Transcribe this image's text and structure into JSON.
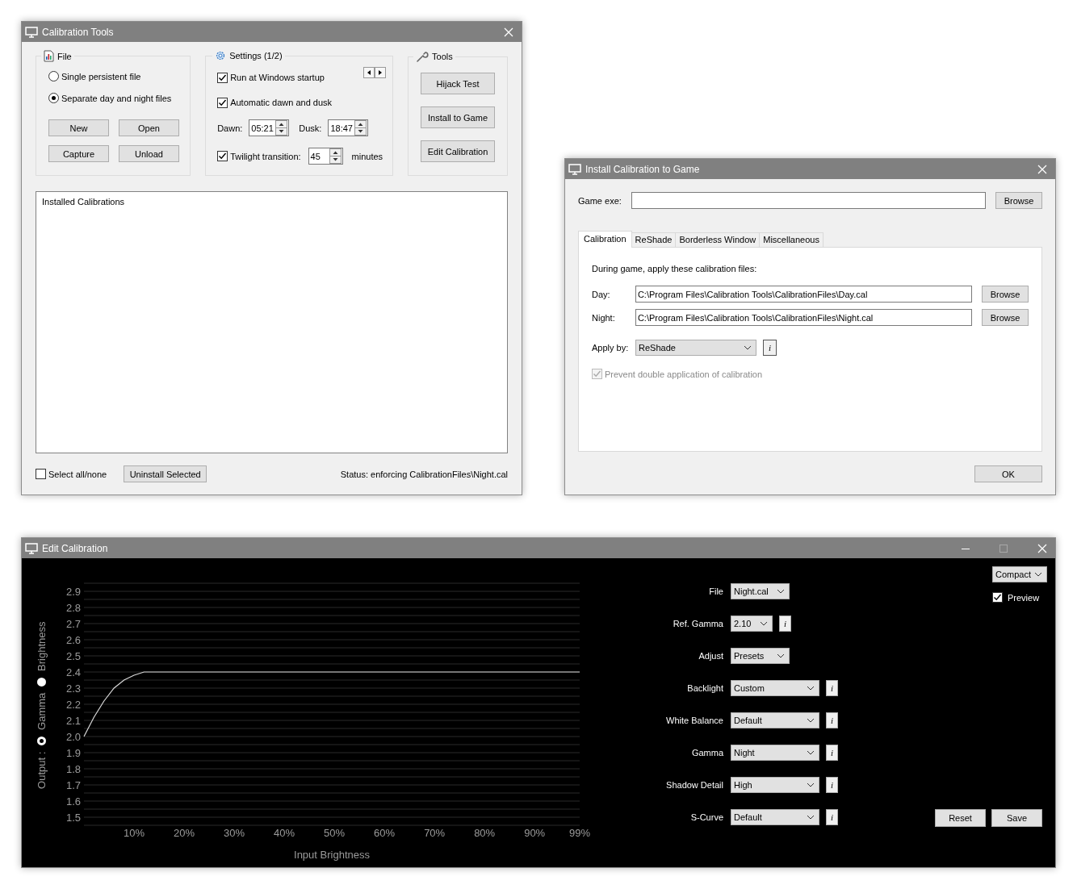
{
  "calibration_tools": {
    "title": "Calibration Tools",
    "file_group": {
      "title": "File",
      "options": [
        {
          "label": "Single persistent file",
          "selected": false
        },
        {
          "label": "Separate day and night files",
          "selected": true
        }
      ],
      "buttons": [
        "New",
        "Open",
        "Capture",
        "Unload"
      ]
    },
    "settings_group": {
      "title": "Settings (1/2)",
      "checkboxes": [
        {
          "label": "Run at Windows startup",
          "checked": true
        },
        {
          "label": "Automatic dawn and dusk",
          "checked": true
        }
      ],
      "dawn": {
        "label": "Dawn:",
        "value": "05:21"
      },
      "dusk": {
        "label": "Dusk:",
        "value": "18:47"
      },
      "twilight": {
        "label": "Twilight transition:",
        "checked": true,
        "value": "45",
        "unit": "minutes"
      }
    },
    "tools_group": {
      "title": "Tools",
      "buttons": [
        "Hijack Test",
        "Install to Game",
        "Edit Calibration"
      ]
    },
    "list": {
      "header": "Installed Calibrations"
    },
    "select_all": {
      "label": "Select all/none",
      "checked": false
    },
    "uninstall_button": "Uninstall Selected",
    "status": "Status: enforcing CalibrationFiles\\Night.cal"
  },
  "install_window": {
    "title": "Install Calibration to Game",
    "game_exe": {
      "label": "Game exe:",
      "button": "Browse"
    },
    "tabs": [
      {
        "label": "Calibration",
        "selected": true
      },
      {
        "label": "ReShade",
        "selected": false
      },
      {
        "label": "Borderless Window",
        "selected": false
      },
      {
        "label": "Miscellaneous",
        "selected": false
      }
    ],
    "intro": "During game, apply these calibration files:",
    "files": [
      {
        "label": "Day:",
        "value": "C:\\Program Files\\Calibration Tools\\CalibrationFiles\\Day.cal",
        "button": "Browse"
      },
      {
        "label": "Night:",
        "value": "C:\\Program Files\\Calibration Tools\\CalibrationFiles\\Night.cal",
        "button": "Browse"
      }
    ],
    "apply_by": {
      "label": "Apply by:",
      "value": "ReShade",
      "info": "i"
    },
    "prevent": {
      "label": "Prevent double application of calibration",
      "checked": true,
      "disabled": true
    },
    "ok_button": "OK"
  },
  "edit_window": {
    "title": "Edit Calibration",
    "output_label": "Output :",
    "axis_options": [
      {
        "label": "Gamma",
        "selected": true
      },
      {
        "label": "Brightness",
        "selected": false
      }
    ],
    "chart_data": {
      "type": "line",
      "xlabel": "Input Brightness",
      "x": [
        0,
        2,
        4,
        6,
        8,
        10,
        12,
        99
      ],
      "series": [
        {
          "color": "#d8d8d8",
          "values": [
            2.0,
            2.12,
            2.22,
            2.3,
            2.35,
            2.38,
            2.4,
            2.4
          ]
        }
      ],
      "grid": true,
      "xlim": [
        0,
        99
      ],
      "ylim": [
        1.45,
        2.95
      ],
      "xticks": [
        {
          "value": 10,
          "label": "10%"
        },
        {
          "value": 20,
          "label": "20%"
        },
        {
          "value": 30,
          "label": "30%"
        },
        {
          "value": 40,
          "label": "40%"
        },
        {
          "value": 50,
          "label": "50%"
        },
        {
          "value": 60,
          "label": "60%"
        },
        {
          "value": 70,
          "label": "70%"
        },
        {
          "value": 80,
          "label": "80%"
        },
        {
          "value": 90,
          "label": "90%"
        },
        {
          "value": 99,
          "label": "99%"
        }
      ],
      "yticks": [
        {
          "value": 1.5,
          "label": "1.5"
        },
        {
          "value": 1.6,
          "label": "1.6"
        },
        {
          "value": 1.7,
          "label": "1.7"
        },
        {
          "value": 1.8,
          "label": "1.8"
        },
        {
          "value": 1.9,
          "label": "1.9"
        },
        {
          "value": 2.0,
          "label": "2.0"
        },
        {
          "value": 2.1,
          "label": "2.1"
        },
        {
          "value": 2.2,
          "label": "2.2"
        },
        {
          "value": 2.3,
          "label": "2.3"
        },
        {
          "value": 2.4,
          "label": "2.4"
        },
        {
          "value": 2.5,
          "label": "2.5"
        },
        {
          "value": 2.6,
          "label": "2.6"
        },
        {
          "value": 2.7,
          "label": "2.7"
        },
        {
          "value": 2.8,
          "label": "2.8"
        },
        {
          "value": 2.9,
          "label": "2.9"
        }
      ]
    },
    "settings": [
      {
        "label": "File",
        "value": "Night.cal",
        "kind": "medium"
      },
      {
        "label": "Ref. Gamma",
        "value": "2.10",
        "kind": "narrow",
        "info": "i"
      },
      {
        "label": "Adjust",
        "value": "Presets",
        "kind": "medium"
      },
      {
        "label": "Backlight",
        "value": "Custom",
        "kind": "wide",
        "info": "i"
      },
      {
        "label": "White Balance",
        "value": "Default",
        "kind": "wide",
        "info": "i"
      },
      {
        "label": "Gamma",
        "value": "Night",
        "kind": "wide",
        "info": "i"
      },
      {
        "label": "Shadow Detail",
        "value": "High",
        "kind": "wide",
        "info": "i"
      },
      {
        "label": "S-Curve",
        "value": "Default",
        "kind": "wide",
        "info": "i"
      }
    ],
    "view": {
      "value": "Compact"
    },
    "preview": {
      "label": "Preview",
      "checked": true
    },
    "buttons": [
      "Reset",
      "Save"
    ]
  }
}
